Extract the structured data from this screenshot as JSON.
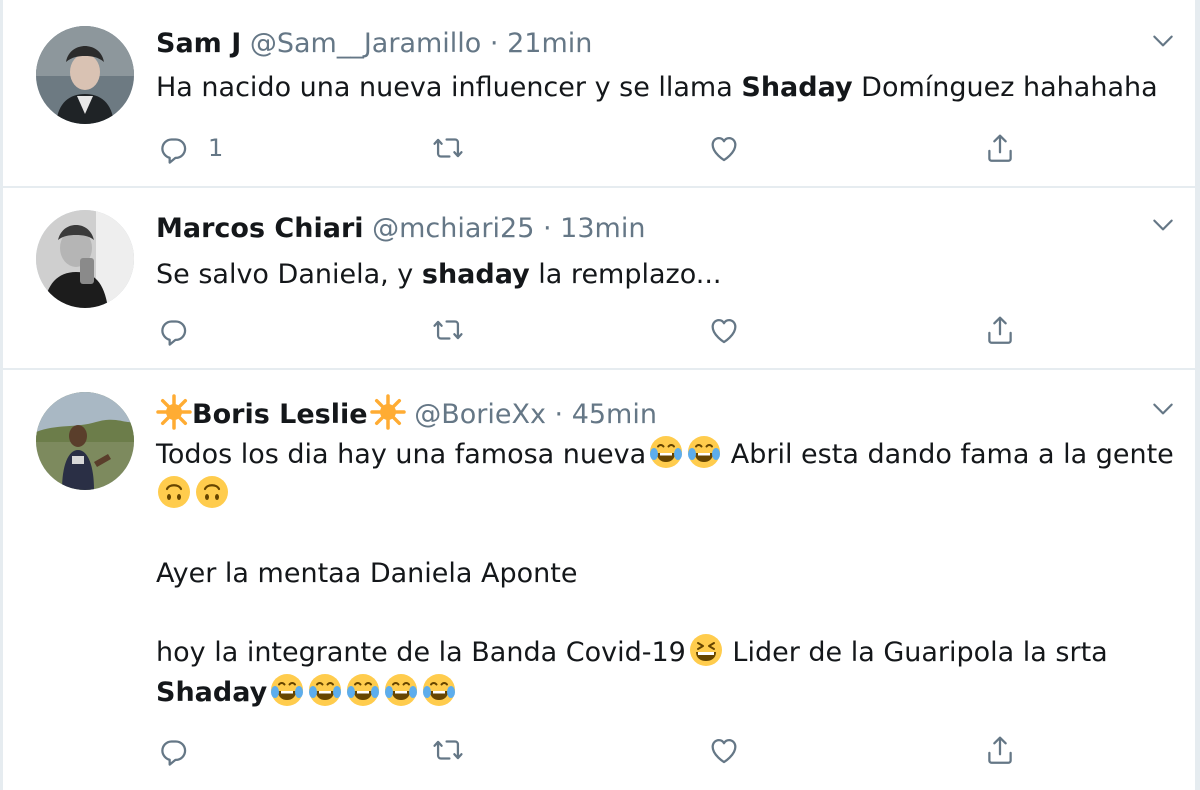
{
  "tweets": [
    {
      "name": "Sam J",
      "handle": "@Sam__Jaramillo",
      "sep": "·",
      "time": "21min",
      "text_before": "Ha nacido una nueva influencer y se llama ",
      "text_bold": "Shaday",
      "text_after": " Domínguez hahahaha",
      "reply_count": "1",
      "avatar_icon": "profile-photo"
    },
    {
      "name": "Marcos Chiari",
      "handle": "@mchiari25",
      "sep": "·",
      "time": "13min",
      "text_before": "Se salvo Daniela,  y ",
      "text_bold": "shaday",
      "text_after": " la remplazo...",
      "reply_count": "",
      "avatar_icon": "profile-photo"
    },
    {
      "name": "Boris Leslie",
      "name_icon": "sun-emoji",
      "handle": "@BorieXx",
      "sep": "·",
      "time": "45min",
      "line1_a": "Todos los dia hay una famosa nueva",
      "line1_emoji": "tears-of-joy-emoji",
      "line1_b": " Abril esta dando fama a la gente",
      "line2_emoji": "upside-down-face-emoji",
      "line3": "Ayer la mentaa Daniela Aponte",
      "line4_a": "hoy la integrante de la Banda Covid-19",
      "line4_emoji": "grinning-squinting-emoji",
      "line4_b": " Lider de la Guaripola la srta",
      "line5_bold": "Shaday",
      "line5_emoji": "tears-of-joy-emoji",
      "reply_count": "",
      "avatar_icon": "profile-photo"
    }
  ],
  "icons": {
    "reply": "reply-icon",
    "retweet": "retweet-icon",
    "like": "heart-icon",
    "share": "share-icon",
    "more": "chevron-down-icon"
  },
  "colors": {
    "icon_gray": "#657786",
    "separator": "#e6ecf0",
    "emoji_yellow": "#ffcc4d",
    "emoji_tear": "#5dadec"
  }
}
